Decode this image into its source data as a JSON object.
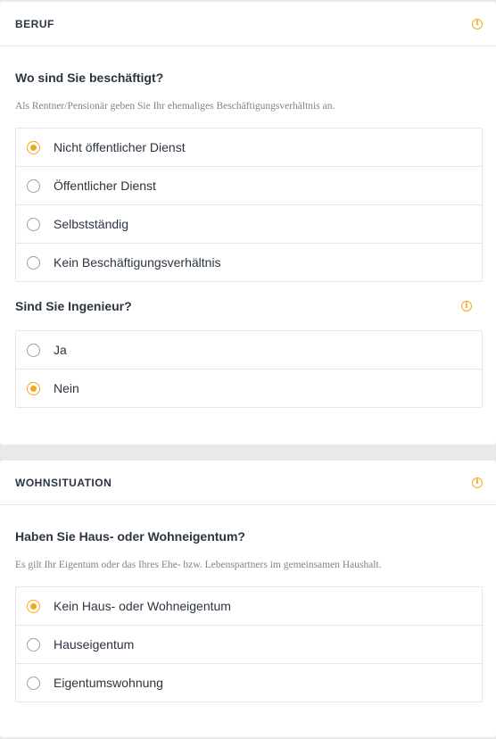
{
  "beruf": {
    "title": "BERUF",
    "q1": {
      "question": "Wo sind Sie beschäftigt?",
      "hint": "Als Rentner/Pensionär geben Sie Ihr ehemaliges Beschäftigungsverhältnis an.",
      "options": [
        {
          "label": "Nicht öffentlicher Dienst",
          "selected": true
        },
        {
          "label": "Öffentlicher Dienst",
          "selected": false
        },
        {
          "label": "Selbstständig",
          "selected": false
        },
        {
          "label": "Kein Beschäftigungsverhältnis",
          "selected": false
        }
      ]
    },
    "q2": {
      "question": "Sind Sie Ingenieur?",
      "options": [
        {
          "label": "Ja",
          "selected": false
        },
        {
          "label": "Nein",
          "selected": true
        }
      ]
    }
  },
  "wohn": {
    "title": "WOHNSITUATION",
    "q1": {
      "question": "Haben Sie Haus- oder Wohneigentum?",
      "hint": "Es gilt Ihr Eigentum oder das Ihres Ehe- bzw. Lebenspartners im gemeinsamen Haushalt.",
      "options": [
        {
          "label": "Kein Haus- oder Wohneigentum",
          "selected": true
        },
        {
          "label": "Hauseigentum",
          "selected": false
        },
        {
          "label": "Eigentumswohnung",
          "selected": false
        }
      ]
    }
  },
  "icons": {
    "info": "info-icon",
    "info_glyph": "i"
  },
  "colors": {
    "accent": "#f3a71c",
    "text": "#2b3540",
    "hint": "#7c848c"
  }
}
